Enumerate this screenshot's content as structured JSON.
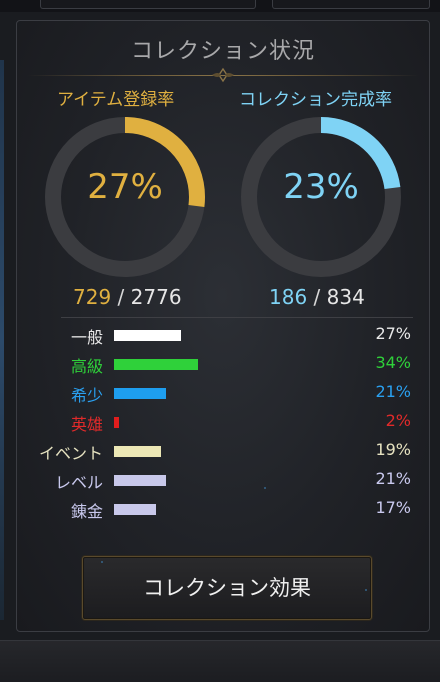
{
  "panel": {
    "title": "コレクション状況"
  },
  "rings": [
    {
      "label": "アイテム登録率",
      "percent_text": "27%",
      "percent": 27,
      "current": "729",
      "separator": "/",
      "total": "2776",
      "color": "#e0b040"
    },
    {
      "label": "コレクション完成率",
      "percent_text": "23%",
      "percent": 23,
      "current": "186",
      "separator": "/",
      "total": "834",
      "color": "#7fd3f5"
    }
  ],
  "grades": [
    {
      "label": "一般",
      "value": "27%",
      "percent": 27,
      "color": "#ffffff"
    },
    {
      "label": "高級",
      "value": "34%",
      "percent": 34,
      "color": "#2fd13a"
    },
    {
      "label": "希少",
      "value": "21%",
      "percent": 21,
      "color": "#1e9eef"
    },
    {
      "label": "英雄",
      "value": "2%",
      "percent": 2,
      "color": "#e11d1d"
    },
    {
      "label": "イベント",
      "value": "19%",
      "percent": 19,
      "color": "#ece7b5"
    },
    {
      "label": "レベル",
      "value": "21%",
      "percent": 21,
      "color": "#c8c8ea"
    },
    {
      "label": "錬金",
      "value": "17%",
      "percent": 17,
      "color": "#c8c8ea"
    }
  ],
  "grade_text_colors": {
    "一般": "#e8e8e8",
    "高級": "#2fd13a",
    "希少": "#2aa0f0",
    "英雄": "#e12a2a",
    "イベント": "#e6e2c0",
    "レベル": "#c9c9ee",
    "錬金": "#c9c9ee"
  },
  "ring_track_color": "#3b3c40",
  "effect_button": {
    "label": "コレクション効果"
  }
}
